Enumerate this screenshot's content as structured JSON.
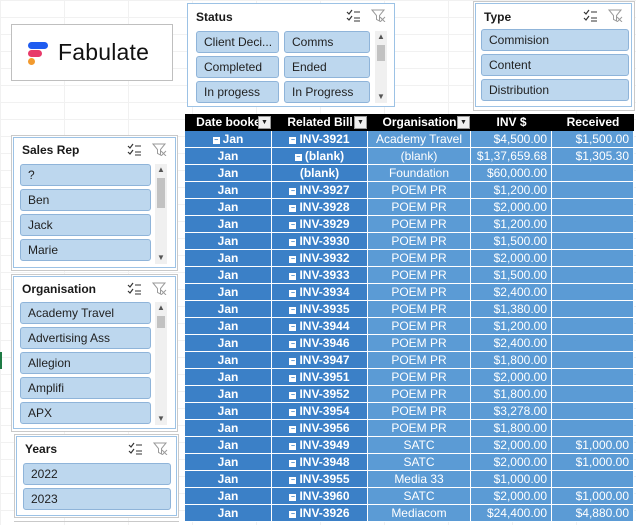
{
  "logo": {
    "text": "Fabulate"
  },
  "status_slicer": {
    "title": "Status",
    "items": [
      "Client Deci...",
      "Comms",
      "Completed",
      "Ended",
      "In progess",
      "In Progress"
    ]
  },
  "type_slicer": {
    "title": "Type",
    "items": [
      "Commision",
      "Content",
      "Distribution"
    ]
  },
  "sales_rep_slicer": {
    "title": "Sales Rep",
    "items": [
      "?",
      "Ben",
      "Jack",
      "Marie"
    ]
  },
  "organisation_slicer": {
    "title": "Organisation",
    "items": [
      "Academy Travel",
      "Advertising Ass",
      "Allegion",
      "Amplifi",
      "APX"
    ]
  },
  "years_slicer": {
    "title": "Years",
    "items": [
      "2022",
      "2023"
    ]
  },
  "pivot": {
    "headers": [
      "Date booke",
      "Related Bill",
      "Organisation",
      "INV $",
      "Received"
    ],
    "rows": [
      {
        "date": "Jan",
        "bill": "INV-3921",
        "org": "Academy Travel",
        "inv": "$4,500.00",
        "rec": "$1,500.00"
      },
      {
        "date": "Jan",
        "bill": "(blank)",
        "org": "(blank)",
        "inv": "$1,37,659.68",
        "rec": "$1,305.30"
      },
      {
        "date": "Jan",
        "bill": "(blank)",
        "org": "Foundation",
        "inv": "$60,000.00",
        "rec": ""
      },
      {
        "date": "Jan",
        "bill": "INV-3927",
        "org": "POEM PR",
        "inv": "$1,200.00",
        "rec": ""
      },
      {
        "date": "Jan",
        "bill": "INV-3928",
        "org": "POEM PR",
        "inv": "$2,000.00",
        "rec": ""
      },
      {
        "date": "Jan",
        "bill": "INV-3929",
        "org": "POEM PR",
        "inv": "$1,200.00",
        "rec": ""
      },
      {
        "date": "Jan",
        "bill": "INV-3930",
        "org": "POEM PR",
        "inv": "$1,500.00",
        "rec": ""
      },
      {
        "date": "Jan",
        "bill": "INV-3932",
        "org": "POEM PR",
        "inv": "$2,000.00",
        "rec": ""
      },
      {
        "date": "Jan",
        "bill": "INV-3933",
        "org": "POEM PR",
        "inv": "$1,500.00",
        "rec": ""
      },
      {
        "date": "Jan",
        "bill": "INV-3934",
        "org": "POEM PR",
        "inv": "$2,400.00",
        "rec": ""
      },
      {
        "date": "Jan",
        "bill": "INV-3935",
        "org": "POEM PR",
        "inv": "$1,380.00",
        "rec": ""
      },
      {
        "date": "Jan",
        "bill": "INV-3944",
        "org": "POEM PR",
        "inv": "$1,200.00",
        "rec": ""
      },
      {
        "date": "Jan",
        "bill": "INV-3946",
        "org": "POEM PR",
        "inv": "$2,400.00",
        "rec": ""
      },
      {
        "date": "Jan",
        "bill": "INV-3947",
        "org": "POEM PR",
        "inv": "$1,800.00",
        "rec": ""
      },
      {
        "date": "Jan",
        "bill": "INV-3951",
        "org": "POEM PR",
        "inv": "$2,000.00",
        "rec": ""
      },
      {
        "date": "Jan",
        "bill": "INV-3952",
        "org": "POEM PR",
        "inv": "$1,800.00",
        "rec": ""
      },
      {
        "date": "Jan",
        "bill": "INV-3954",
        "org": "POEM PR",
        "inv": "$3,278.00",
        "rec": ""
      },
      {
        "date": "Jan",
        "bill": "INV-3956",
        "org": "POEM PR",
        "inv": "$1,800.00",
        "rec": ""
      },
      {
        "date": "Jan",
        "bill": "INV-3949",
        "org": "SATC",
        "inv": "$2,000.00",
        "rec": "$1,000.00"
      },
      {
        "date": "Jan",
        "bill": "INV-3948",
        "org": "SATC",
        "inv": "$2,000.00",
        "rec": "$1,000.00"
      },
      {
        "date": "Jan",
        "bill": "INV-3955",
        "org": "Media 33",
        "inv": "$1,000.00",
        "rec": ""
      },
      {
        "date": "Jan",
        "bill": "INV-3960",
        "org": "SATC",
        "inv": "$2,000.00",
        "rec": "$1,000.00"
      },
      {
        "date": "Jan",
        "bill": "INV-3926",
        "org": "Mediacom",
        "inv": "$24,400.00",
        "rec": "$4,880.00"
      }
    ]
  },
  "colors": {
    "slicer_button": "#bdd7ee",
    "pivot_cell": "#5b9bd5",
    "pivot_header": "#000000"
  }
}
